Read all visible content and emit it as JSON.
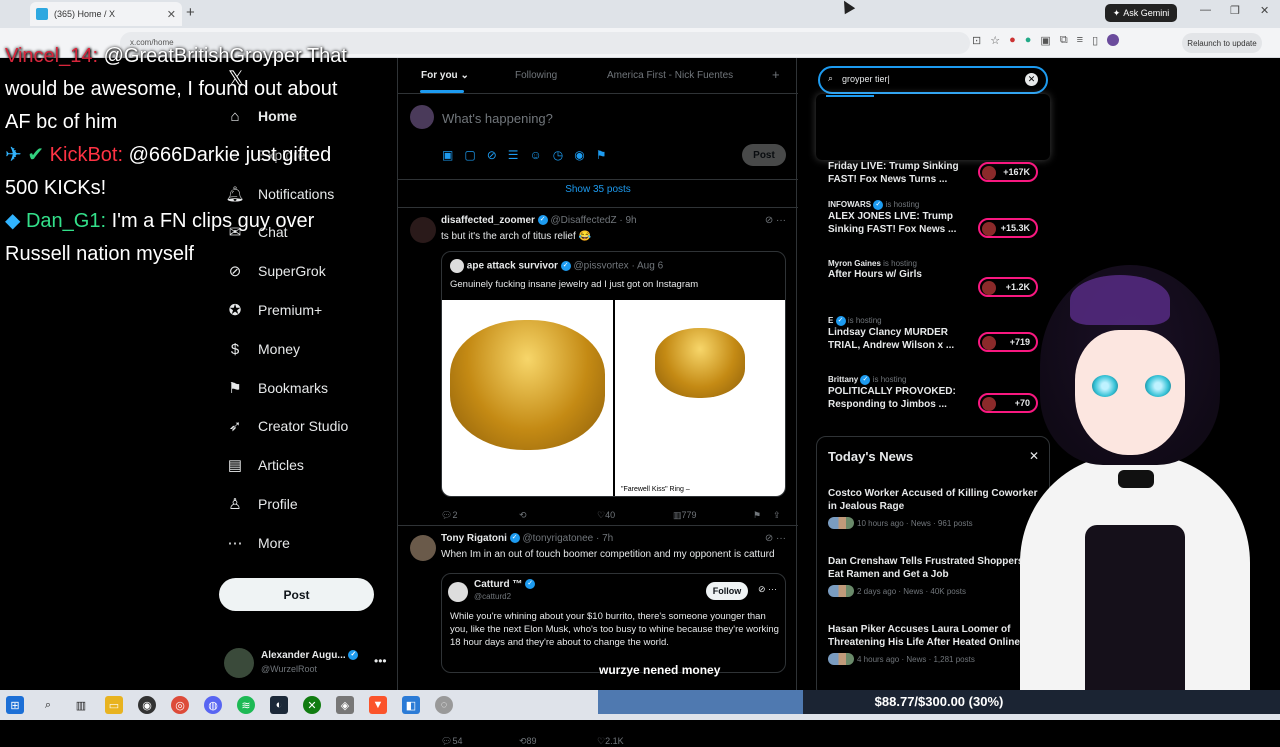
{
  "browser": {
    "tab_title": "(365) Home / X",
    "url": "x.com/home",
    "gemini_label": "Ask Gemini",
    "relaunch_label": "Relaunch to update"
  },
  "chat": [
    {
      "user": "Vincel_14:",
      "text": " @GreatBritishGroyper That would be awesome, I found out about AF bc of him"
    },
    {
      "user": "KickBot:",
      "text": " @666Darkie just gifted 500 KICKs!"
    },
    {
      "user": "Dan_G1:",
      "text": " I'm a FN clips guy over Russell nation myself"
    }
  ],
  "nav": {
    "items": [
      "Home",
      "Explore",
      "Notifications",
      "Chat",
      "SuperGrok",
      "Premium+",
      "Money",
      "Bookmarks",
      "Creator Studio",
      "Articles",
      "Profile",
      "More"
    ],
    "post_label": "Post",
    "account_name": "Alexander Augu...",
    "account_handle": "@WurzelRoot"
  },
  "feed": {
    "tabs": [
      "For you",
      "Following",
      "America First - Nick Fuentes"
    ],
    "compose_placeholder": "What's happening?",
    "compose_post": "Post",
    "show_posts": "Show 35 posts",
    "tweet1": {
      "name": "disaffected_zoomer",
      "handle": "@DisaffectedZ · 9h",
      "text": "ts but it's the arch of titus relief 😂",
      "quote_name": "ape attack survivor",
      "quote_handle": "@pissvortex · Aug 6",
      "quote_text": "Genuinely fucking insane jewelry ad I just got on Instagram",
      "img_caption": "\"Farewell Kiss\" Ring –",
      "actions": [
        "2",
        "",
        "40",
        "779"
      ]
    },
    "tweet2": {
      "name": "Tony Rigatoni",
      "handle": "@tonyrigatonee · 7h",
      "text": "When Im in an out of touch boomer competition and my opponent is catturd",
      "quote_name": "Catturd ™",
      "quote_handle": "@catturd2",
      "follow": "Follow",
      "quote_text": "While you're whining about your $10 burrito, there's someone younger than you, like the next Elon Musk, who's too busy to whine because they're working 18 hour days and they're about to change the world.",
      "actions": [
        "54",
        "89",
        "2.1K"
      ]
    },
    "caption": "wurzye nened money"
  },
  "right": {
    "search_value": "groyper tier",
    "live": [
      {
        "host": "",
        "title": "Friday LIVE: Trump Sinking FAST! Fox News Turns ...",
        "count": "+167K"
      },
      {
        "host": "INFOWARS",
        "title": "ALEX JONES LIVE: Trump Sinking FAST! Fox News ...",
        "count": "+15.3K"
      },
      {
        "host": "Myron Gaines",
        "title": "After Hours w/ Girls",
        "count": "+1.2K"
      },
      {
        "host": "E",
        "title": "Lindsay Clancy MURDER TRIAL, Andrew Wilson x ...",
        "count": "+719"
      },
      {
        "host": "Brittany",
        "title": "POLITICALLY PROVOKED: Responding to Jimbos ...",
        "count": "+70"
      }
    ],
    "is_hosting": "is hosting",
    "news_title": "Today's News",
    "news": [
      {
        "title": "Costco Worker Accused of Killing Coworker in Jealous Rage",
        "meta": "10 hours ago · News · 961 posts"
      },
      {
        "title": "Dan Crenshaw Tells Frustrated Shoppers to Eat Ramen and Get a Job",
        "meta": "2 days ago · News · 40K posts"
      },
      {
        "title": "Hasan Piker Accuses Laura Loomer of Threatening His Life After Heated Online...",
        "meta": "4 hours ago · News · 1,281 posts"
      }
    ]
  },
  "donation": {
    "text": "$88.77/$300.00 (30%)",
    "progress": 0.3
  }
}
